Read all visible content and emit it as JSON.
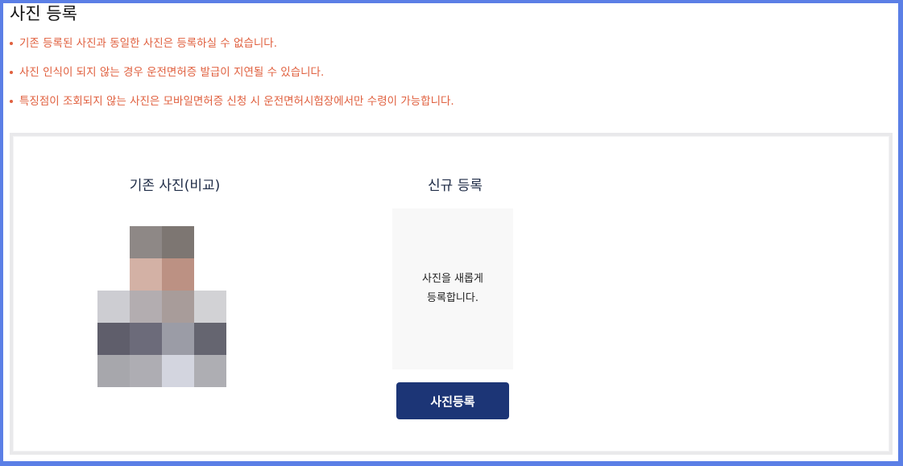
{
  "page": {
    "title": "사진 등록",
    "notices": [
      "기존 등록된 사진과 동일한 사진은 등록하실 수 없습니다.",
      "사진 인식이 되지 않는 경우 운전면허증 발급이 지연될 수 있습니다.",
      "특징점이 조회되지 않는 사진은 모바일면허증 신청 시 운전면허시험장에서만 수령이 가능합니다."
    ]
  },
  "existing_photo": {
    "heading": "기존 사진(비교)",
    "pixel_colors": [
      [
        "#ffffff",
        "#8e8886",
        "#7d7672",
        "#ffffff"
      ],
      [
        "#ffffff",
        "#d3b1a5",
        "#bc9183",
        "#ffffff"
      ],
      [
        "#cdcdd2",
        "#b3adb0",
        "#a89c9a",
        "#d2d2d5"
      ],
      [
        "#5f5e6b",
        "#6c6b7a",
        "#9b9ca6",
        "#656570"
      ],
      [
        "#a7a7ac",
        "#aeadb3",
        "#d3d5df",
        "#aeaeb3"
      ]
    ]
  },
  "new_photo": {
    "heading": "신규 등록",
    "box_line1": "사진을 새롭게",
    "box_line2": "등록합니다.",
    "button_label": "사진등록"
  },
  "colors": {
    "notice": "#e0603f",
    "button": "#1c3576",
    "frame": "#5b7fe6"
  }
}
